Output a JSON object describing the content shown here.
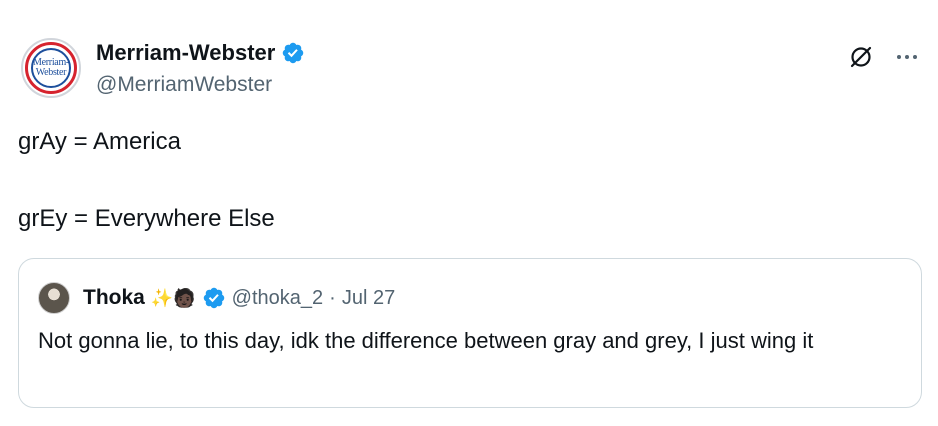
{
  "author": {
    "display_name": "Merriam-Webster",
    "handle": "@MerriamWebster",
    "avatar_text_line1": "Merriam-",
    "avatar_text_line2": "Webster"
  },
  "tweet": {
    "line1": "grAy = America",
    "line2": "grEy = Everywhere Else"
  },
  "quoted": {
    "display_name": "Thoka",
    "emoji": "✨🧑🏿",
    "handle": "@thoka_2",
    "separator": "·",
    "date": "Jul 27",
    "text": "Not gonna lie, to this day, idk the difference between gray and grey, I just wing it"
  },
  "icons": {
    "verified": "verified-badge-icon",
    "grok": "grok-icon",
    "more": "more-options-icon"
  },
  "colors": {
    "verified_blue": "#1d9bf0",
    "secondary_text": "#536471",
    "primary_text": "#0f1419",
    "quote_border": "#cfd9de"
  }
}
